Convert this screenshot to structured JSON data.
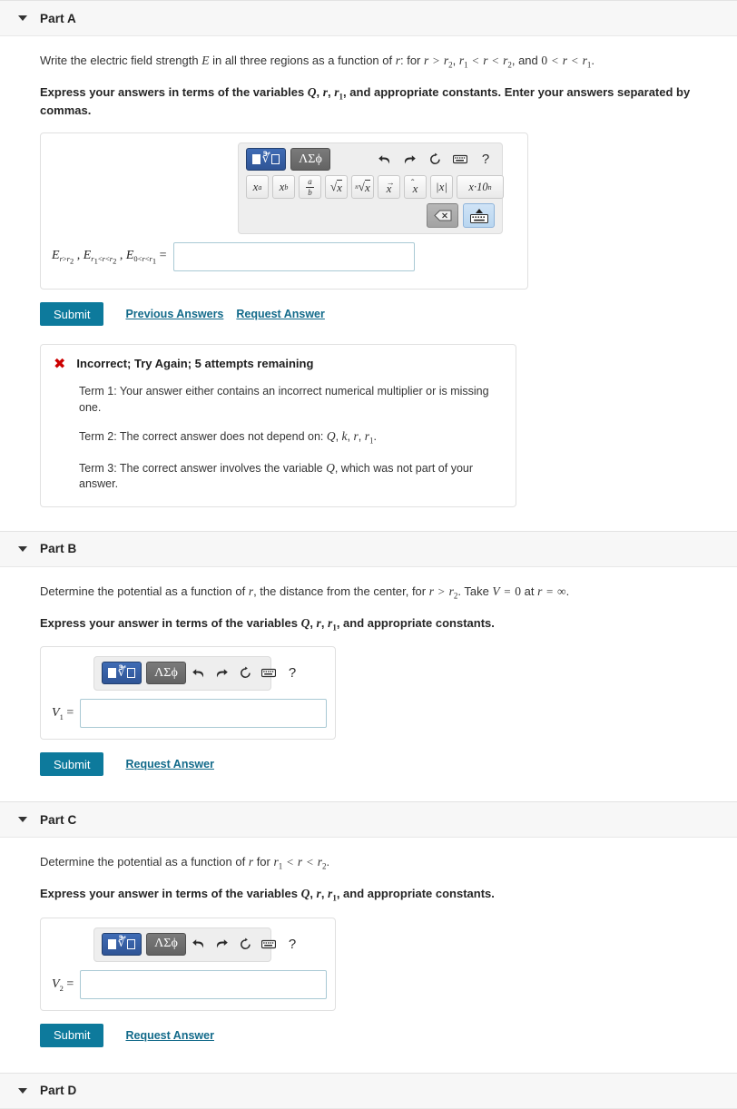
{
  "parts": [
    {
      "id": "a",
      "title": "Part A",
      "prompt_plain": "Write the electric field strength E in all three regions as a function of r: for r > r2, r1 < r < r2, and 0 < r < r1.",
      "instruction_plain": "Express your answers in terms of the variables Q, r, r1, and appropriate constants. Enter your answers separated by commas.",
      "answer_label_plain": "E_{r>r2} , E_{r1<r<r2} , E_{0<r<r1} =",
      "answer_value": "",
      "submit_label": "Submit",
      "previous_answers_label": "Previous Answers",
      "request_answer_label": "Request Answer",
      "feedback": {
        "status_icon": "x-mark-icon",
        "title": "Incorrect; Try Again; 5 attempts remaining",
        "terms": [
          "Term 1: Your answer either contains an incorrect numerical multiplier or is missing one.",
          "Term 2: The correct answer does not depend on: Q, k, r, r1.",
          "Term 3: The correct answer involves the variable Q, which was not part of your answer."
        ]
      }
    },
    {
      "id": "b",
      "title": "Part B",
      "prompt_plain": "Determine the potential as a function of r, the distance from the center, for r > r2. Take V = 0 at r = ∞.",
      "instruction_plain": "Express your answer in terms of the variables Q, r, r1, and appropriate constants.",
      "answer_label_plain": "V1 =",
      "answer_value": "",
      "submit_label": "Submit",
      "request_answer_label": "Request Answer"
    },
    {
      "id": "c",
      "title": "Part C",
      "prompt_plain": "Determine the potential as a function of r for r1 < r < r2.",
      "instruction_plain": "Express your answer in terms of the variables Q, r, r1, and appropriate constants.",
      "answer_label_plain": "V2 =",
      "answer_value": "",
      "submit_label": "Submit",
      "request_answer_label": "Request Answer"
    },
    {
      "id": "d",
      "title": "Part D"
    }
  ],
  "palette": {
    "mode_math_icon": "math-template-icon",
    "mode_greek_label": "ΛΣϕ",
    "tools": [
      {
        "name": "undo-icon",
        "title": "Undo"
      },
      {
        "name": "redo-icon",
        "title": "Redo"
      },
      {
        "name": "reset-icon",
        "title": "Reset"
      },
      {
        "name": "keyboard-icon",
        "title": "Keyboard"
      },
      {
        "name": "help-icon",
        "title": "Help",
        "glyph": "?"
      }
    ],
    "keys": [
      {
        "name": "superscript-key",
        "label": "x^a"
      },
      {
        "name": "subscript-key",
        "label": "x_b"
      },
      {
        "name": "fraction-key",
        "label": "a/b"
      },
      {
        "name": "square-root-key",
        "label": "√x"
      },
      {
        "name": "nth-root-key",
        "label": "n√x"
      },
      {
        "name": "vector-key",
        "label": "vec x"
      },
      {
        "name": "unit-vector-key",
        "label": "hat x"
      },
      {
        "name": "absolute-value-key",
        "label": "|x|"
      },
      {
        "name": "scientific-notation-key",
        "label": "x•10^n"
      }
    ],
    "backspace_icon": "backspace-icon",
    "keyboard_toggle_icon": "keyboard-up-icon"
  },
  "colors": {
    "accent": "#0d7a9c",
    "link": "#126a8a",
    "error": "#cc0000",
    "header_bg": "#f7f7f7",
    "palette_bg": "#eeeeee",
    "mode_active": "#2f5596",
    "input_border": "#a9c9d4"
  }
}
